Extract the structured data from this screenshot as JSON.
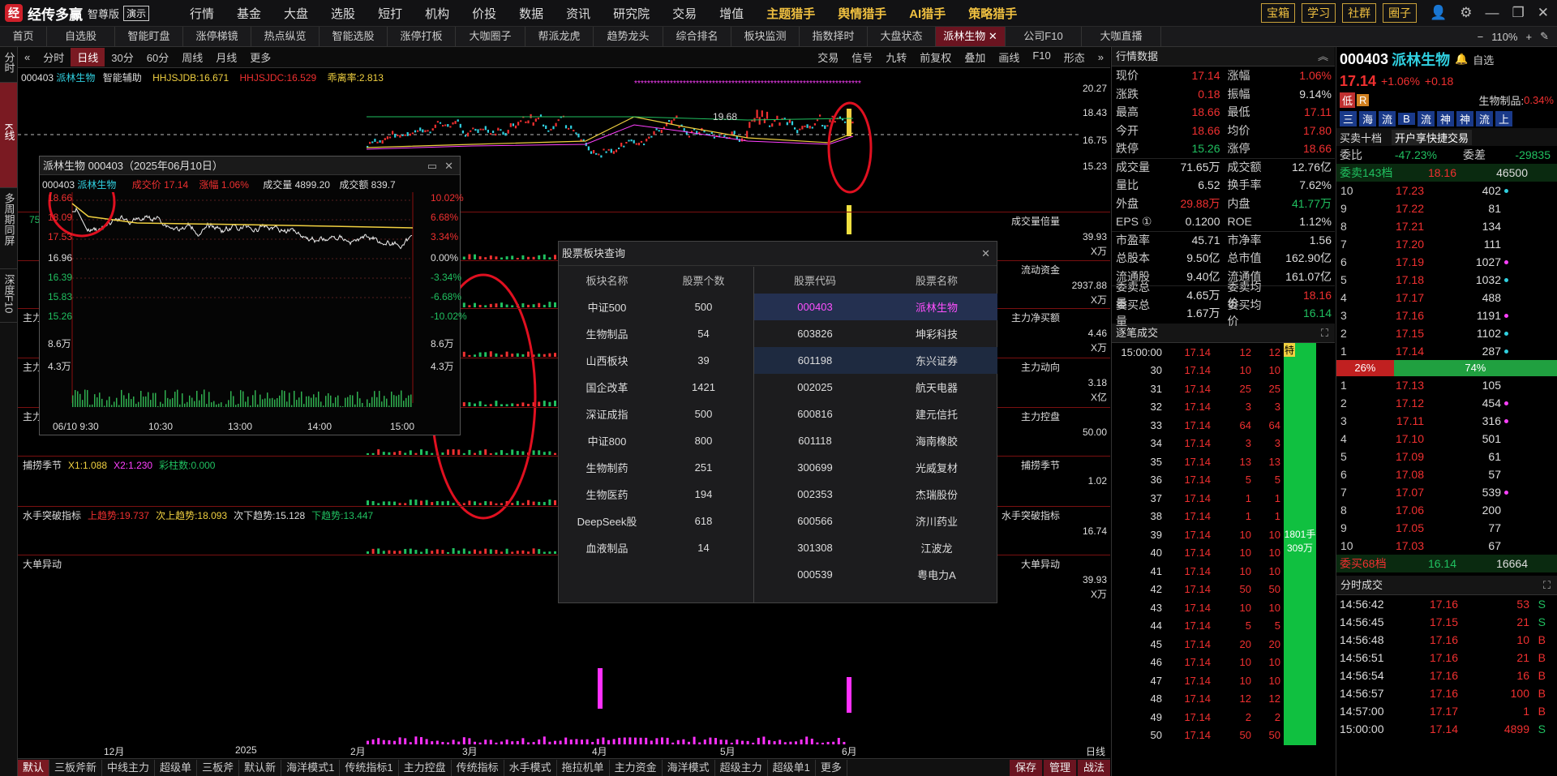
{
  "app": {
    "name": "经传多赢",
    "edition": "智尊版",
    "demo": "演示"
  },
  "top_menu": [
    {
      "label": "行情"
    },
    {
      "label": "基金"
    },
    {
      "label": "大盘"
    },
    {
      "label": "选股"
    },
    {
      "label": "短打"
    },
    {
      "label": "机构"
    },
    {
      "label": "价投"
    },
    {
      "label": "数据"
    },
    {
      "label": "资讯"
    },
    {
      "label": "研究院"
    },
    {
      "label": "交易"
    },
    {
      "label": "增值"
    },
    {
      "label": "主题猎手"
    },
    {
      "label": "舆情猎手"
    },
    {
      "label": "AI猎手"
    },
    {
      "label": "策略猎手"
    }
  ],
  "top_buttons": [
    "宝箱",
    "学习",
    "社群",
    "圈子"
  ],
  "tabs": [
    {
      "label": "首页"
    },
    {
      "label": "自选股"
    },
    {
      "label": "智能盯盘"
    },
    {
      "label": "涨停梯镜"
    },
    {
      "label": "热点纵览"
    },
    {
      "label": "智能选股"
    },
    {
      "label": "涨停打板"
    },
    {
      "label": "大咖圈子"
    },
    {
      "label": "帮派龙虎"
    },
    {
      "label": "趋势龙头"
    },
    {
      "label": "综合排名"
    },
    {
      "label": "板块监测"
    },
    {
      "label": "指数择时"
    },
    {
      "label": "大盘状态"
    },
    {
      "label": "派林生物"
    },
    {
      "label": "公司F10"
    },
    {
      "label": "大咖直播"
    }
  ],
  "zoom": "110%",
  "left_tabs": [
    "分时",
    "K线",
    "多周期同屏",
    "深度F10"
  ],
  "periods": [
    "分时",
    "日线",
    "30分",
    "60分",
    "周线",
    "月线",
    "更多"
  ],
  "chart_tools": [
    "交易",
    "信号",
    "九转",
    "前复权",
    "叠加",
    "画线",
    "F10",
    "形态"
  ],
  "indicator_header": {
    "code": "000403",
    "name": "派林生物",
    "assist": "智能辅助",
    "hh1": "HHJSJDB:16.671",
    "hh2": "HHJSJDC:16.529",
    "ratio": "乖离率:2.813"
  },
  "price_axis": [
    "20.27",
    "18.43",
    "16.75",
    "15.23"
  ],
  "high_mark": "19.68",
  "popup": {
    "title": "派林生物 000403（2025年06月10日）",
    "code": "000403",
    "name": "派林生物",
    "deal_label": "成交价",
    "deal": "17.14",
    "chg_label": "涨幅",
    "chg": "1.06%",
    "vol_label": "成交量",
    "vol": "4899.20",
    "amt_label": "成交额",
    "amt": "839.7",
    "left_axis": [
      "18.66",
      "18.09",
      "17.53",
      "16.96",
      "16.39",
      "15.83",
      "15.26",
      "8.6万",
      "4.3万"
    ],
    "right_axis": [
      "10.02%",
      "6.68%",
      "3.34%",
      "0.00%",
      "-3.34%",
      "-6.68%",
      "-10.02%",
      "8.6万",
      "4.3万"
    ],
    "times": [
      "06/10 9:30",
      "10:30",
      "13:00",
      "14:00",
      "15:00"
    ]
  },
  "panes": [
    {
      "title": "",
      "items": [
        {
          "t": "7535",
          "c": "grn"
        }
      ],
      "right": "成交量倍量",
      "axis": [
        "39.93",
        "X万"
      ]
    },
    {
      "title": "",
      "items": [],
      "right": "流动资金",
      "axis": [
        "2937.88",
        "X万"
      ]
    },
    {
      "title": "主力净买额",
      "items": [
        {
          "t": "主力净买额:-1718.7",
          "c": "grn"
        }
      ],
      "right": "主力净买额",
      "axis": [
        "4.46",
        "X万"
      ]
    },
    {
      "title": "主力动向",
      "items": [
        {
          "t": "大额主动净买:9346.74万",
          "c": "red"
        },
        {
          "t": "MA3:2793.52万",
          "c": "yel"
        },
        {
          "t": "MA5:1875.51万",
          "c": "mag"
        },
        {
          "t": "大额主动净买占比:7.33%",
          "c": "red"
        }
      ],
      "right": "主力动向",
      "axis": [
        "3.18",
        "X亿"
      ]
    },
    {
      "title": "主力控盘",
      "items": [
        {
          "t": "控盘程度:0.000",
          "c": "yel"
        },
        {
          "t": "高控盘:100.000",
          "c": "red"
        }
      ],
      "right": "主力控盘",
      "axis": [
        "50.00"
      ]
    },
    {
      "title": "捕捞季节",
      "items": [
        {
          "t": "X1:1.088",
          "c": "yel"
        },
        {
          "t": "X2:1.230",
          "c": "mag"
        },
        {
          "t": "彩柱数:0.000",
          "c": "grn"
        }
      ],
      "right": "捕捞季节",
      "axis": [
        "1.02"
      ]
    },
    {
      "title": "水手突破指标",
      "items": [
        {
          "t": "上趋势:19.737",
          "c": "red"
        },
        {
          "t": "次上趋势:18.093",
          "c": "yel"
        },
        {
          "t": "次下趋势:15.128",
          "c": "wht"
        },
        {
          "t": "下趋势:13.447",
          "c": "grn"
        }
      ],
      "right": "水手突破指标",
      "axis": [
        "16.74"
      ]
    },
    {
      "title": "大单异动",
      "items": [],
      "right": "大单异动",
      "axis": [
        "39.93",
        "X万"
      ]
    }
  ],
  "x_axis": [
    "12月",
    "2025",
    "2月",
    "3月",
    "4月",
    "5月",
    "6月"
  ],
  "x_axis_right": "日线",
  "dialog": {
    "title": "股票板块查询",
    "h1": "板块名称",
    "h2": "股票个数",
    "h3": "股票代码",
    "h4": "股票名称",
    "sectors": [
      {
        "name": "中证500",
        "count": "500"
      },
      {
        "name": "生物制品",
        "count": "54"
      },
      {
        "name": "山西板块",
        "count": "39"
      },
      {
        "name": "国企改革",
        "count": "1421"
      },
      {
        "name": "深证成指",
        "count": "500"
      },
      {
        "name": "中证800",
        "count": "800"
      },
      {
        "name": "生物制药",
        "count": "251"
      },
      {
        "name": "生物医药",
        "count": "194"
      },
      {
        "name": "DeepSeek股",
        "count": "618"
      },
      {
        "name": "血液制品",
        "count": "14"
      }
    ],
    "stocks": [
      {
        "code": "000403",
        "name": "派林生物"
      },
      {
        "code": "603826",
        "name": "坤彩科技"
      },
      {
        "code": "601198",
        "name": "东兴证券"
      },
      {
        "code": "002025",
        "name": "航天电器"
      },
      {
        "code": "600816",
        "name": "建元信托"
      },
      {
        "code": "601118",
        "name": "海南橡胶"
      },
      {
        "code": "300699",
        "name": "光威复材"
      },
      {
        "code": "002353",
        "name": "杰瑞股份"
      },
      {
        "code": "600566",
        "name": "济川药业"
      },
      {
        "code": "301308",
        "name": "江波龙"
      },
      {
        "code": "000539",
        "name": "粤电力A"
      }
    ]
  },
  "bottom_tabs": [
    "默认",
    "三板斧新",
    "中线主力",
    "超级单",
    "三板斧",
    "默认新",
    "海洋模式1",
    "传统指标1",
    "主力控盘",
    "传统指标",
    "水手模式",
    "拖拉机单",
    "主力资金",
    "海洋模式",
    "超级主力",
    "超级单1",
    "更多"
  ],
  "bottom_buttons": [
    "保存",
    "管理",
    "战法"
  ],
  "quote": {
    "title": "行情数据",
    "rows": [
      [
        {
          "k": "现价",
          "v": "17.14",
          "c": "red"
        },
        {
          "k": "涨幅",
          "v": "1.06%",
          "c": "red"
        }
      ],
      [
        {
          "k": "涨跌",
          "v": "0.18",
          "c": "red"
        },
        {
          "k": "振幅",
          "v": "9.14%",
          "c": "wht"
        }
      ],
      [
        {
          "k": "最高",
          "v": "18.66",
          "c": "red"
        },
        {
          "k": "最低",
          "v": "17.11",
          "c": "red"
        }
      ],
      [
        {
          "k": "今开",
          "v": "18.66",
          "c": "red"
        },
        {
          "k": "均价",
          "v": "17.80",
          "c": "red"
        }
      ],
      [
        {
          "k": "跌停",
          "v": "15.26",
          "c": "grn"
        },
        {
          "k": "涨停",
          "v": "18.66",
          "c": "red"
        }
      ],
      [
        {
          "k": "成交量",
          "v": "71.65万",
          "c": "wht"
        },
        {
          "k": "成交额",
          "v": "12.76亿",
          "c": "wht"
        }
      ],
      [
        {
          "k": "量比",
          "v": "6.52",
          "c": "wht"
        },
        {
          "k": "换手率",
          "v": "7.62%",
          "c": "wht"
        }
      ],
      [
        {
          "k": "外盘",
          "v": "29.88万",
          "c": "red"
        },
        {
          "k": "内盘",
          "v": "41.77万",
          "c": "grn"
        }
      ],
      [
        {
          "k": "EPS ①",
          "v": "0.1200",
          "c": "wht"
        },
        {
          "k": "ROE",
          "v": "1.12%",
          "c": "wht"
        }
      ],
      [
        {
          "k": "市盈率",
          "v": "45.71",
          "c": "wht"
        },
        {
          "k": "市净率",
          "v": "1.56",
          "c": "wht"
        }
      ],
      [
        {
          "k": "总股本",
          "v": "9.50亿",
          "c": "wht"
        },
        {
          "k": "总市值",
          "v": "162.90亿",
          "c": "wht"
        }
      ],
      [
        {
          "k": "流通股",
          "v": "9.40亿",
          "c": "wht"
        },
        {
          "k": "流通值",
          "v": "161.07亿",
          "c": "wht"
        }
      ],
      [
        {
          "k": "委卖总量",
          "v": "4.65万",
          "c": "wht"
        },
        {
          "k": "委卖均价",
          "v": "18.16",
          "c": "red"
        }
      ],
      [
        {
          "k": "委买总量",
          "v": "1.67万",
          "c": "wht"
        },
        {
          "k": "委买均价",
          "v": "16.14",
          "c": "grn"
        }
      ]
    ],
    "trades_title": "逐笔成交",
    "trades": [
      {
        "t": "15:00:00",
        "p": "17.14",
        "v": "12",
        "v2": "12"
      },
      {
        "t": "30",
        "p": "17.14",
        "v": "10",
        "v2": "10"
      },
      {
        "t": "31",
        "p": "17.14",
        "v": "25",
        "v2": "25"
      },
      {
        "t": "32",
        "p": "17.14",
        "v": "3",
        "v2": "3"
      },
      {
        "t": "33",
        "p": "17.14",
        "v": "64",
        "v2": "64"
      },
      {
        "t": "34",
        "p": "17.14",
        "v": "3",
        "v2": "3"
      },
      {
        "t": "35",
        "p": "17.14",
        "v": "13",
        "v2": "13"
      },
      {
        "t": "36",
        "p": "17.14",
        "v": "5",
        "v2": "5"
      },
      {
        "t": "37",
        "p": "17.14",
        "v": "1",
        "v2": "1"
      },
      {
        "t": "38",
        "p": "17.14",
        "v": "1",
        "v2": "1"
      },
      {
        "t": "39",
        "p": "17.14",
        "v": "10",
        "v2": "10"
      },
      {
        "t": "40",
        "p": "17.14",
        "v": "10",
        "v2": "10"
      },
      {
        "t": "41",
        "p": "17.14",
        "v": "10",
        "v2": "10"
      },
      {
        "t": "42",
        "p": "17.14",
        "v": "50",
        "v2": "50"
      },
      {
        "t": "43",
        "p": "17.14",
        "v": "10",
        "v2": "10"
      },
      {
        "t": "44",
        "p": "17.14",
        "v": "5",
        "v2": "5"
      },
      {
        "t": "45",
        "p": "17.14",
        "v": "20",
        "v2": "20"
      },
      {
        "t": "46",
        "p": "17.14",
        "v": "10",
        "v2": "10"
      },
      {
        "t": "47",
        "p": "17.14",
        "v": "10",
        "v2": "10"
      },
      {
        "t": "48",
        "p": "17.14",
        "v": "12",
        "v2": "12"
      },
      {
        "t": "49",
        "p": "17.14",
        "v": "2",
        "v2": "2"
      },
      {
        "t": "50",
        "p": "17.14",
        "v": "50",
        "v2": "50"
      }
    ],
    "bigorder": {
      "badge": "特",
      "hands": "1801手",
      "amount": "309万"
    }
  },
  "book": {
    "code": "000403",
    "name": "派林生物",
    "price": "17.14",
    "chg": "+1.06%",
    "chgv": "+0.18",
    "sector": "生物制品:",
    "sector_chg": "0.34%",
    "tags": [
      "低",
      "R"
    ],
    "pager": [
      "自选"
    ],
    "bar_labels": [
      "三",
      "海",
      "流",
      "B",
      "流",
      "神",
      "神",
      "流",
      "上"
    ],
    "top10": "买卖十档",
    "fast": "开户享快捷交易",
    "ratio_label": "委比",
    "ratio": "-47.23%",
    "diff_label": "委差",
    "diff": "-29835",
    "sell_head": {
      "t": "委卖143档",
      "p": "18.16",
      "v": "46500"
    },
    "sells": [
      {
        "l": "10",
        "p": "17.23",
        "v": "402"
      },
      {
        "l": "9",
        "p": "17.22",
        "v": "81"
      },
      {
        "l": "8",
        "p": "17.21",
        "v": "134"
      },
      {
        "l": "7",
        "p": "17.20",
        "v": "111"
      },
      {
        "l": "6",
        "p": "17.19",
        "v": "1027"
      },
      {
        "l": "5",
        "p": "17.18",
        "v": "1032"
      },
      {
        "l": "4",
        "p": "17.17",
        "v": "488"
      },
      {
        "l": "3",
        "p": "17.16",
        "v": "1191"
      },
      {
        "l": "2",
        "p": "17.15",
        "v": "1102"
      },
      {
        "l": "1",
        "p": "17.14",
        "v": "287"
      }
    ],
    "bar_sell": "26%",
    "bar_buy": "74%",
    "bar_buy_frac": 0.74,
    "buys": [
      {
        "l": "1",
        "p": "17.13",
        "v": "105"
      },
      {
        "l": "2",
        "p": "17.12",
        "v": "454"
      },
      {
        "l": "3",
        "p": "17.11",
        "v": "316"
      },
      {
        "l": "4",
        "p": "17.10",
        "v": "501"
      },
      {
        "l": "5",
        "p": "17.09",
        "v": "61"
      },
      {
        "l": "6",
        "p": "17.08",
        "v": "57"
      },
      {
        "l": "7",
        "p": "17.07",
        "v": "539"
      },
      {
        "l": "8",
        "p": "17.06",
        "v": "200"
      },
      {
        "l": "9",
        "p": "17.05",
        "v": "77"
      },
      {
        "l": "10",
        "p": "17.03",
        "v": "67"
      }
    ],
    "buy_head": {
      "t": "委买68档",
      "p": "16.14",
      "v": "16664"
    },
    "tick_title": "分时成交",
    "ticks": [
      {
        "t": "14:56:42",
        "p": "17.16",
        "v": "53",
        "s": "S"
      },
      {
        "t": "14:56:45",
        "p": "17.15",
        "v": "21",
        "s": "S"
      },
      {
        "t": "14:56:48",
        "p": "17.16",
        "v": "10",
        "s": "B"
      },
      {
        "t": "14:56:51",
        "p": "17.16",
        "v": "21",
        "s": "B"
      },
      {
        "t": "14:56:54",
        "p": "17.16",
        "v": "16",
        "s": "B"
      },
      {
        "t": "14:56:57",
        "p": "17.16",
        "v": "100",
        "s": "B"
      },
      {
        "t": "14:57:00",
        "p": "17.17",
        "v": "1",
        "s": "B"
      },
      {
        "t": "15:00:00",
        "p": "17.14",
        "v": "4899",
        "s": "S"
      }
    ]
  },
  "colors": {
    "accent": "#7a1a22",
    "up": "#f03030",
    "down": "#20c060",
    "gold": "#f0c040"
  }
}
